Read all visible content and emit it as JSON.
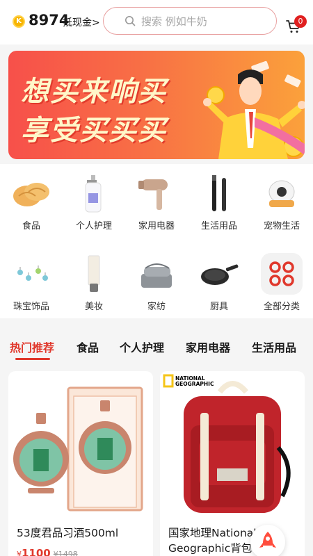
{
  "header": {
    "coin_symbol": "K",
    "points": "8974",
    "points_unit": "抵现金>",
    "search_placeholder": "搜索 例如牛奶",
    "cart_count": "0"
  },
  "banner": {
    "line1": "想买来响买",
    "line2": "享受买买买"
  },
  "categories": [
    {
      "label": "食品",
      "icon": "biscuit-icon"
    },
    {
      "label": "个人护理",
      "icon": "lotion-bottle-icon"
    },
    {
      "label": "家用电器",
      "icon": "hair-dryer-icon"
    },
    {
      "label": "生活用品",
      "icon": "electric-toothbrush-icon"
    },
    {
      "label": "宠物生活",
      "icon": "pet-house-icon"
    },
    {
      "label": "珠宝饰品",
      "icon": "earrings-icon"
    },
    {
      "label": "美妆",
      "icon": "cosmetic-tube-icon"
    },
    {
      "label": "家纺",
      "icon": "blanket-icon"
    },
    {
      "label": "厨具",
      "icon": "frying-pan-icon"
    },
    {
      "label": "全部分类",
      "icon": "all-categories-icon"
    }
  ],
  "tabs": [
    "热门推荐",
    "食品",
    "个人护理",
    "家用电器",
    "生活用品"
  ],
  "products": [
    {
      "name": "53度君品习酒500ml",
      "price_symbol": "¥",
      "price": "1100",
      "old_price": "¥1498"
    },
    {
      "name": "国家地理National Geographic背包",
      "logo_text": "NATIONAL GEOGRAPHIC"
    }
  ],
  "colors": {
    "accent": "#e0382c",
    "coin": "#f7b500"
  }
}
